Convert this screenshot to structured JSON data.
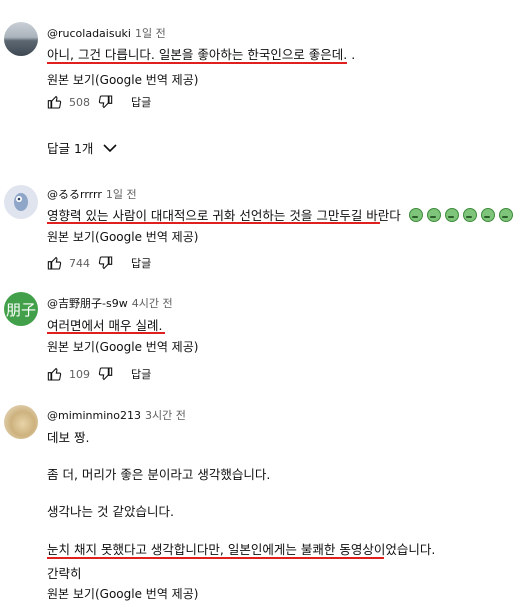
{
  "comments": [
    {
      "author": "@rucoladaisuki",
      "time": "1일 전",
      "text": "아니, 그건 다릅니다. 일본을 좋아하는 한국인으로 좋은데. .",
      "translate": "원본 보기(Google 번역 제공)",
      "likes": "508",
      "reply": "답글"
    },
    {
      "author": "@るるrrrrr",
      "time": "1일 전",
      "text": "영향력 있는 사람이 대대적으로 귀화 선언하는 것을 그만두길 바란다",
      "translate": "원본 보기(Google 번역 제공)",
      "likes": "744",
      "reply": "답글"
    },
    {
      "author": "@吉野朋子-s9w",
      "time": "4시간 전",
      "avatar_text": "朋子",
      "text": "여러면에서 매우 실례.",
      "translate": "원본 보기(Google 번역 제공)",
      "likes": "109",
      "reply": "답글"
    },
    {
      "author": "@miminmino213",
      "time": "3시간 전",
      "lines": [
        "데보 짱.",
        "좀 더, 머리가 좋은 분이라고 생각했습니다.",
        "생각나는 것 같았습니다.",
        "눈치 채지 못했다고 생각합니다만, 일본인에게는 불쾌한 동영상이었습니다.",
        "간략히"
      ],
      "translate": "원본 보기(Google 번역 제공)"
    }
  ],
  "replies_toggle": "답글 1개",
  "colors": {
    "underline": "#e0201e",
    "meta": "#606060"
  }
}
